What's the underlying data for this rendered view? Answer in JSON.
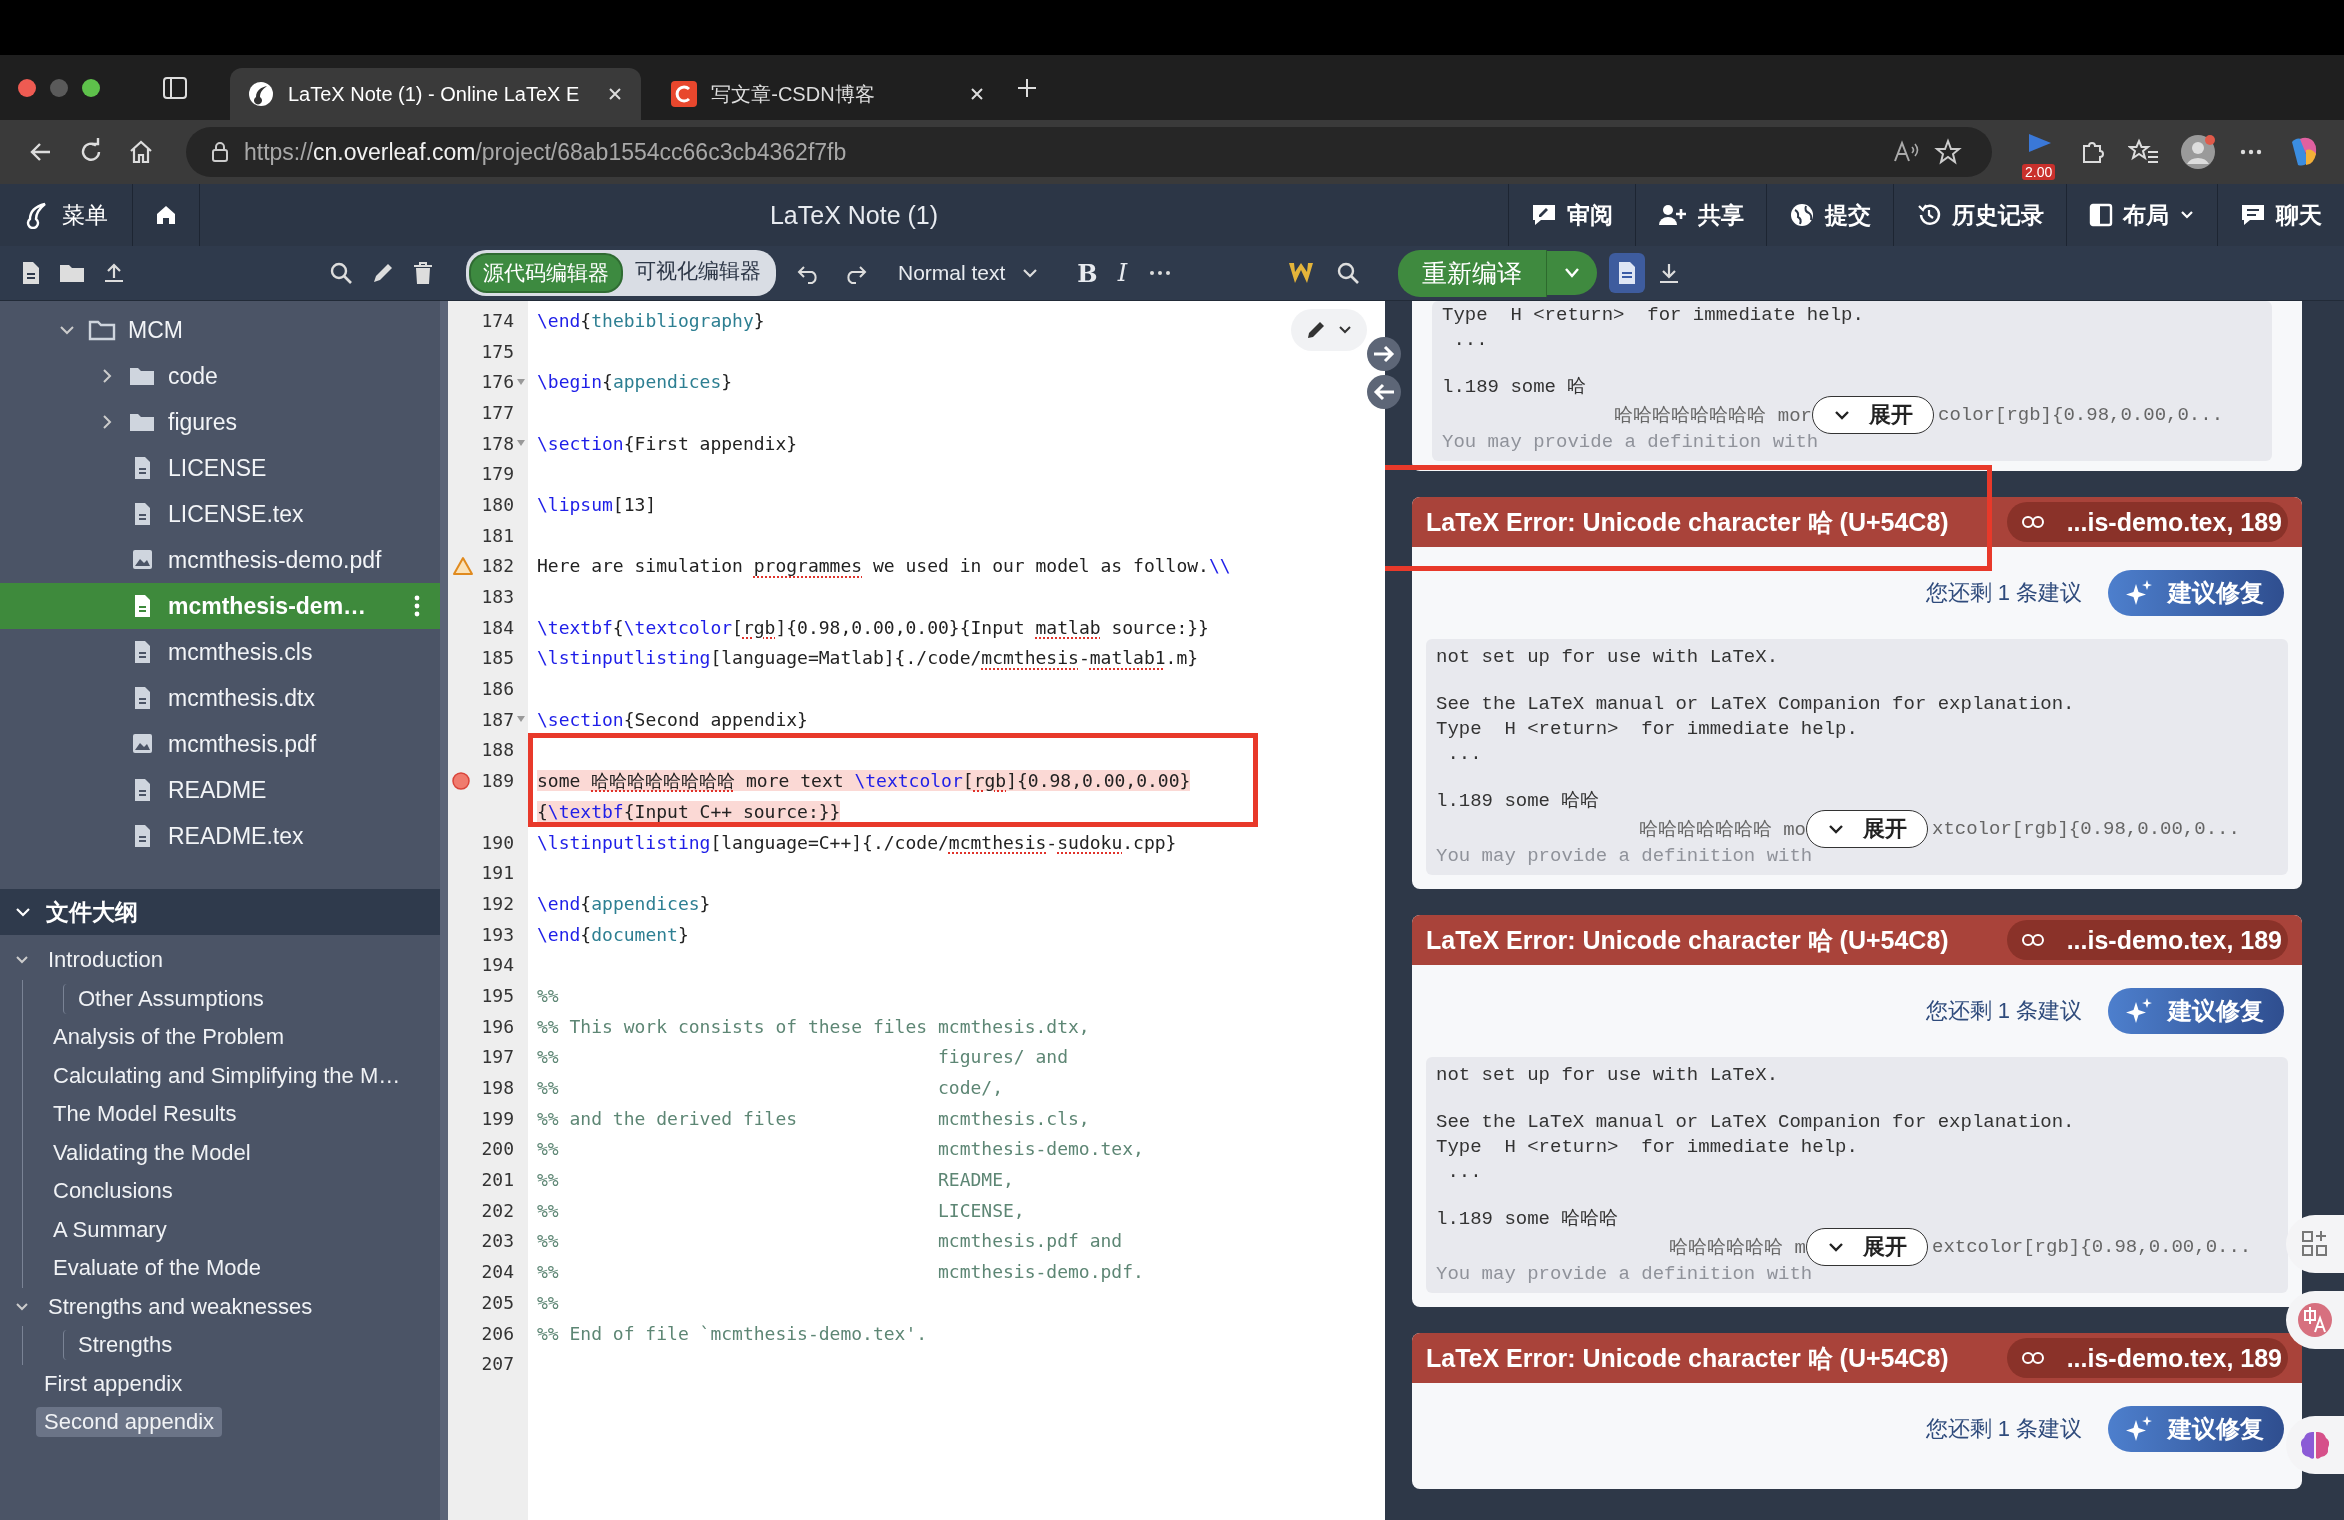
{
  "browser": {
    "tabs": [
      {
        "title": "LaTeX Note (1) - Online LaTeX E",
        "selected": true
      },
      {
        "title": "写文章-CSDN博客",
        "selected": false
      }
    ],
    "url": {
      "scheme": "https://",
      "host": "cn.overleaf.com",
      "path": "/project/68ab1554cc66c3cb4362f7fb"
    },
    "extension_badge": "2.00"
  },
  "app_header": {
    "menu_label": "菜单",
    "title": "LaTeX Note (1)",
    "actions": [
      {
        "label": "审阅",
        "dropdown": false
      },
      {
        "label": "共享",
        "dropdown": false
      },
      {
        "label": "提交",
        "dropdown": false
      },
      {
        "label": "历史记录",
        "dropdown": false
      },
      {
        "label": "布局",
        "dropdown": true
      },
      {
        "label": "聊天",
        "dropdown": false
      }
    ]
  },
  "toolbar": {
    "editor_modes": [
      {
        "label": "源代码编辑器",
        "selected": true
      },
      {
        "label": "可视化编辑器",
        "selected": false
      }
    ],
    "text_style": "Normal text",
    "bold_label": "B",
    "italic_label": "I",
    "recompile_label": "重新编译",
    "pdf_view_selected": true
  },
  "file_tree": [
    {
      "name": "MCM",
      "kind": "folder",
      "expanded": true,
      "children": [
        {
          "name": "code",
          "kind": "folder",
          "expanded": false,
          "selected": false
        },
        {
          "name": "figures",
          "kind": "folder",
          "expanded": false,
          "selected": false
        },
        {
          "name": "LICENSE",
          "kind": "file",
          "selected": false
        },
        {
          "name": "LICENSE.tex",
          "kind": "file",
          "selected": false
        },
        {
          "name": "mcmthesis-demo.pdf",
          "kind": "image",
          "selected": false
        },
        {
          "name": "mcmthesis-dem…",
          "kind": "file",
          "selected": true
        },
        {
          "name": "mcmthesis.cls",
          "kind": "file",
          "selected": false
        },
        {
          "name": "mcmthesis.dtx",
          "kind": "file",
          "selected": false
        },
        {
          "name": "mcmthesis.pdf",
          "kind": "image",
          "selected": false
        },
        {
          "name": "README",
          "kind": "file",
          "selected": false
        },
        {
          "name": "README.tex",
          "kind": "file",
          "selected": false
        }
      ]
    }
  ],
  "outline": {
    "title": "文件大纲",
    "expanded": true,
    "items": [
      {
        "title": "Introduction",
        "expanded": true,
        "selected": false,
        "children": [
          {
            "title": "Other Assumptions",
            "kind": "deep",
            "selected": false
          },
          {
            "title": "Analysis of the Problem",
            "kind": "flat",
            "selected": false
          },
          {
            "title": "Calculating and Simplifying the M…",
            "kind": "flat",
            "selected": false
          },
          {
            "title": "The Model Results",
            "kind": "flat",
            "selected": false
          },
          {
            "title": "Validating the Model",
            "kind": "flat",
            "selected": false
          },
          {
            "title": "Conclusions",
            "kind": "flat",
            "selected": false
          },
          {
            "title": "A Summary",
            "kind": "flat",
            "selected": false
          },
          {
            "title": "Evaluate of the Mode",
            "kind": "flat",
            "selected": false
          }
        ]
      },
      {
        "title": "Strengths and weaknesses",
        "expanded": true,
        "selected": false,
        "children": [
          {
            "title": "Strengths",
            "kind": "deep",
            "selected": false
          }
        ]
      },
      {
        "title": "First appendix",
        "selected": false
      },
      {
        "title": "Second appendix",
        "selected": true
      }
    ]
  },
  "editor": {
    "lines": [
      {
        "n": "174",
        "segs": [
          {
            "kind": "cmd",
            "text": "\\end"
          },
          {
            "kind": "plain",
            "text": "{"
          },
          {
            "kind": "arg",
            "text": "thebibliography"
          },
          {
            "kind": "plain",
            "text": "}"
          }
        ]
      },
      {
        "n": "175"
      },
      {
        "n": "176",
        "fold": true,
        "segs": [
          {
            "kind": "cmd",
            "text": "\\begin"
          },
          {
            "kind": "plain",
            "text": "{"
          },
          {
            "kind": "arg",
            "text": "appendices"
          },
          {
            "kind": "plain",
            "text": "}"
          }
        ]
      },
      {
        "n": "177"
      },
      {
        "n": "178",
        "fold": true,
        "segs": [
          {
            "kind": "cmd",
            "text": "\\section"
          },
          {
            "kind": "plain",
            "text": "{First appendix}"
          }
        ]
      },
      {
        "n": "179"
      },
      {
        "n": "180",
        "segs": [
          {
            "kind": "cmd",
            "text": "\\lipsum"
          },
          {
            "kind": "plain",
            "text": "[13]"
          }
        ]
      },
      {
        "n": "181"
      },
      {
        "n": "182",
        "kind": "warning",
        "segs": [
          {
            "kind": "plain",
            "text": "Here are simulation "
          },
          {
            "kind": "plain",
            "text": "programmes",
            "spell": true
          },
          {
            "kind": "plain",
            "text": " we used in our model as follow."
          },
          {
            "kind": "cmd",
            "text": "\\\\"
          }
        ]
      },
      {
        "n": "183"
      },
      {
        "n": "184",
        "segs": [
          {
            "kind": "cmd",
            "text": "\\textbf"
          },
          {
            "kind": "plain",
            "text": "{"
          },
          {
            "kind": "cmd",
            "text": "\\textcolor"
          },
          {
            "kind": "plain",
            "text": "["
          },
          {
            "kind": "plain",
            "text": "rgb",
            "spell": true
          },
          {
            "kind": "plain",
            "text": "]{0.98,0.00,0.00}{Input "
          },
          {
            "kind": "plain",
            "text": "matlab",
            "spell": true
          },
          {
            "kind": "plain",
            "text": " source:}}"
          }
        ]
      },
      {
        "n": "185",
        "segs": [
          {
            "kind": "cmd",
            "text": "\\lstinputlisting"
          },
          {
            "kind": "plain",
            "text": "[language=Matlab]{./code/"
          },
          {
            "kind": "plain",
            "text": "mcmthesis",
            "spell": true
          },
          {
            "kind": "plain",
            "text": "-"
          },
          {
            "kind": "plain",
            "text": "matlab1",
            "spell": true
          },
          {
            "kind": "plain",
            "text": ".m}"
          }
        ]
      },
      {
        "n": "186"
      },
      {
        "n": "187",
        "fold": true,
        "segs": [
          {
            "kind": "cmd",
            "text": "\\section"
          },
          {
            "kind": "plain",
            "text": "{Second appendix}"
          }
        ]
      },
      {
        "n": "188"
      },
      {
        "n": "189",
        "kind": "error",
        "annotated": true,
        "segs": [
          {
            "kind": "plain",
            "text": "some "
          },
          {
            "kind": "plain",
            "text": "哈哈哈哈哈哈哈哈",
            "spell": true
          },
          {
            "kind": "plain",
            "text": " more text "
          },
          {
            "kind": "cmd",
            "text": "\\textcolor"
          },
          {
            "kind": "plain",
            "text": "["
          },
          {
            "kind": "plain",
            "text": "rgb",
            "spell": true
          },
          {
            "kind": "plain",
            "text": "]{0.98,0.00,0.00}"
          }
        ],
        "cont": [
          {
            "kind": "plain",
            "text": "{"
          },
          {
            "kind": "cmd",
            "text": "\\textbf"
          },
          {
            "kind": "plain",
            "text": "{Input C++ source:}}"
          }
        ]
      },
      {
        "n": "190",
        "segs": [
          {
            "kind": "cmd",
            "text": "\\lstinputlisting"
          },
          {
            "kind": "plain",
            "text": "[language=C++]{./code/"
          },
          {
            "kind": "plain",
            "text": "mcmthesis",
            "spell": true
          },
          {
            "kind": "plain",
            "text": "-"
          },
          {
            "kind": "plain",
            "text": "sudoku",
            "spell": true
          },
          {
            "kind": "plain",
            "text": ".cpp}"
          }
        ]
      },
      {
        "n": "191"
      },
      {
        "n": "192",
        "segs": [
          {
            "kind": "cmd",
            "text": "\\end"
          },
          {
            "kind": "plain",
            "text": "{"
          },
          {
            "kind": "arg",
            "text": "appendices"
          },
          {
            "kind": "plain",
            "text": "}"
          }
        ]
      },
      {
        "n": "193",
        "segs": [
          {
            "kind": "cmd",
            "text": "\\end"
          },
          {
            "kind": "plain",
            "text": "{"
          },
          {
            "kind": "arg",
            "text": "document"
          },
          {
            "kind": "plain",
            "text": "}"
          }
        ]
      },
      {
        "n": "194"
      },
      {
        "n": "195",
        "segs": [
          {
            "kind": "comment",
            "text": "%%"
          }
        ]
      },
      {
        "n": "196",
        "segs": [
          {
            "kind": "comment",
            "text": "%% This work consists of these files mcmthesis.dtx,"
          }
        ]
      },
      {
        "n": "197",
        "segs": [
          {
            "kind": "comment",
            "text": "%%                                   figures/ and"
          }
        ]
      },
      {
        "n": "198",
        "segs": [
          {
            "kind": "comment",
            "text": "%%                                   code/,"
          }
        ]
      },
      {
        "n": "199",
        "segs": [
          {
            "kind": "comment",
            "text": "%% and the derived files             mcmthesis.cls,"
          }
        ]
      },
      {
        "n": "200",
        "segs": [
          {
            "kind": "comment",
            "text": "%%                                   mcmthesis-demo.tex,"
          }
        ]
      },
      {
        "n": "201",
        "segs": [
          {
            "kind": "comment",
            "text": "%%                                   README,"
          }
        ]
      },
      {
        "n": "202",
        "segs": [
          {
            "kind": "comment",
            "text": "%%                                   LICENSE,"
          }
        ]
      },
      {
        "n": "203",
        "segs": [
          {
            "kind": "comment",
            "text": "%%                                   mcmthesis.pdf and"
          }
        ]
      },
      {
        "n": "204",
        "segs": [
          {
            "kind": "comment",
            "text": "%%                                   mcmthesis-demo.pdf."
          }
        ]
      },
      {
        "n": "205",
        "segs": [
          {
            "kind": "comment",
            "text": "%%"
          }
        ]
      },
      {
        "n": "206",
        "segs": [
          {
            "kind": "comment",
            "text": "%% End of file `mcmthesis-demo.tex'."
          }
        ]
      },
      {
        "n": "207"
      }
    ]
  },
  "logs": {
    "cards": [
      {
        "log": [
          [
            "Type  H <return>  for immediate help.",
            " ..."
          ],
          [
            "l.189 some 哈"
          ]
        ],
        "split": {
          "left": "哈哈哈哈哈哈哈哈 mor",
          "right": "color[rgb]{0.98,0.00,0..."
        },
        "faded": "You may provide a definition with",
        "expand_label": "展开"
      },
      {
        "title": "LaTeX Error: Unicode character 哈 (U+54C8)",
        "location": "...is-demo.tex, 189",
        "marked": true,
        "suggestions_left": "您还剩 1 条建议",
        "fix_label": "建议修复",
        "log": [
          [
            "not set up for use with LaTeX."
          ],
          [
            "See the LaTeX manual or LaTeX Companion for explanation.",
            "Type  H <return>  for immediate help.",
            " ..."
          ],
          [
            "l.189 some 哈哈"
          ]
        ],
        "split": {
          "left": "哈哈哈哈哈哈哈 mo",
          "right": "xtcolor[rgb]{0.98,0.00,0..."
        },
        "faded": "You may provide a definition with",
        "expand_label": "展开"
      },
      {
        "title": "LaTeX Error: Unicode character 哈 (U+54C8)",
        "location": "...is-demo.tex, 189",
        "marked": false,
        "suggestions_left": "您还剩 1 条建议",
        "fix_label": "建议修复",
        "log": [
          [
            "not set up for use with LaTeX."
          ],
          [
            "See the LaTeX manual or LaTeX Companion for explanation.",
            "Type  H <return>  for immediate help.",
            " ..."
          ],
          [
            "l.189 some 哈哈哈"
          ]
        ],
        "split": {
          "left": "哈哈哈哈哈哈 m",
          "right": "extcolor[rgb]{0.98,0.00,0..."
        },
        "faded": "You may provide a definition with",
        "expand_label": "展开"
      },
      {
        "title": "LaTeX Error: Unicode character 哈 (U+54C8)",
        "location": "...is-demo.tex, 189",
        "marked": false,
        "suggestions_left": "您还剩 1 条建议",
        "fix_label": "建议修复"
      }
    ]
  }
}
